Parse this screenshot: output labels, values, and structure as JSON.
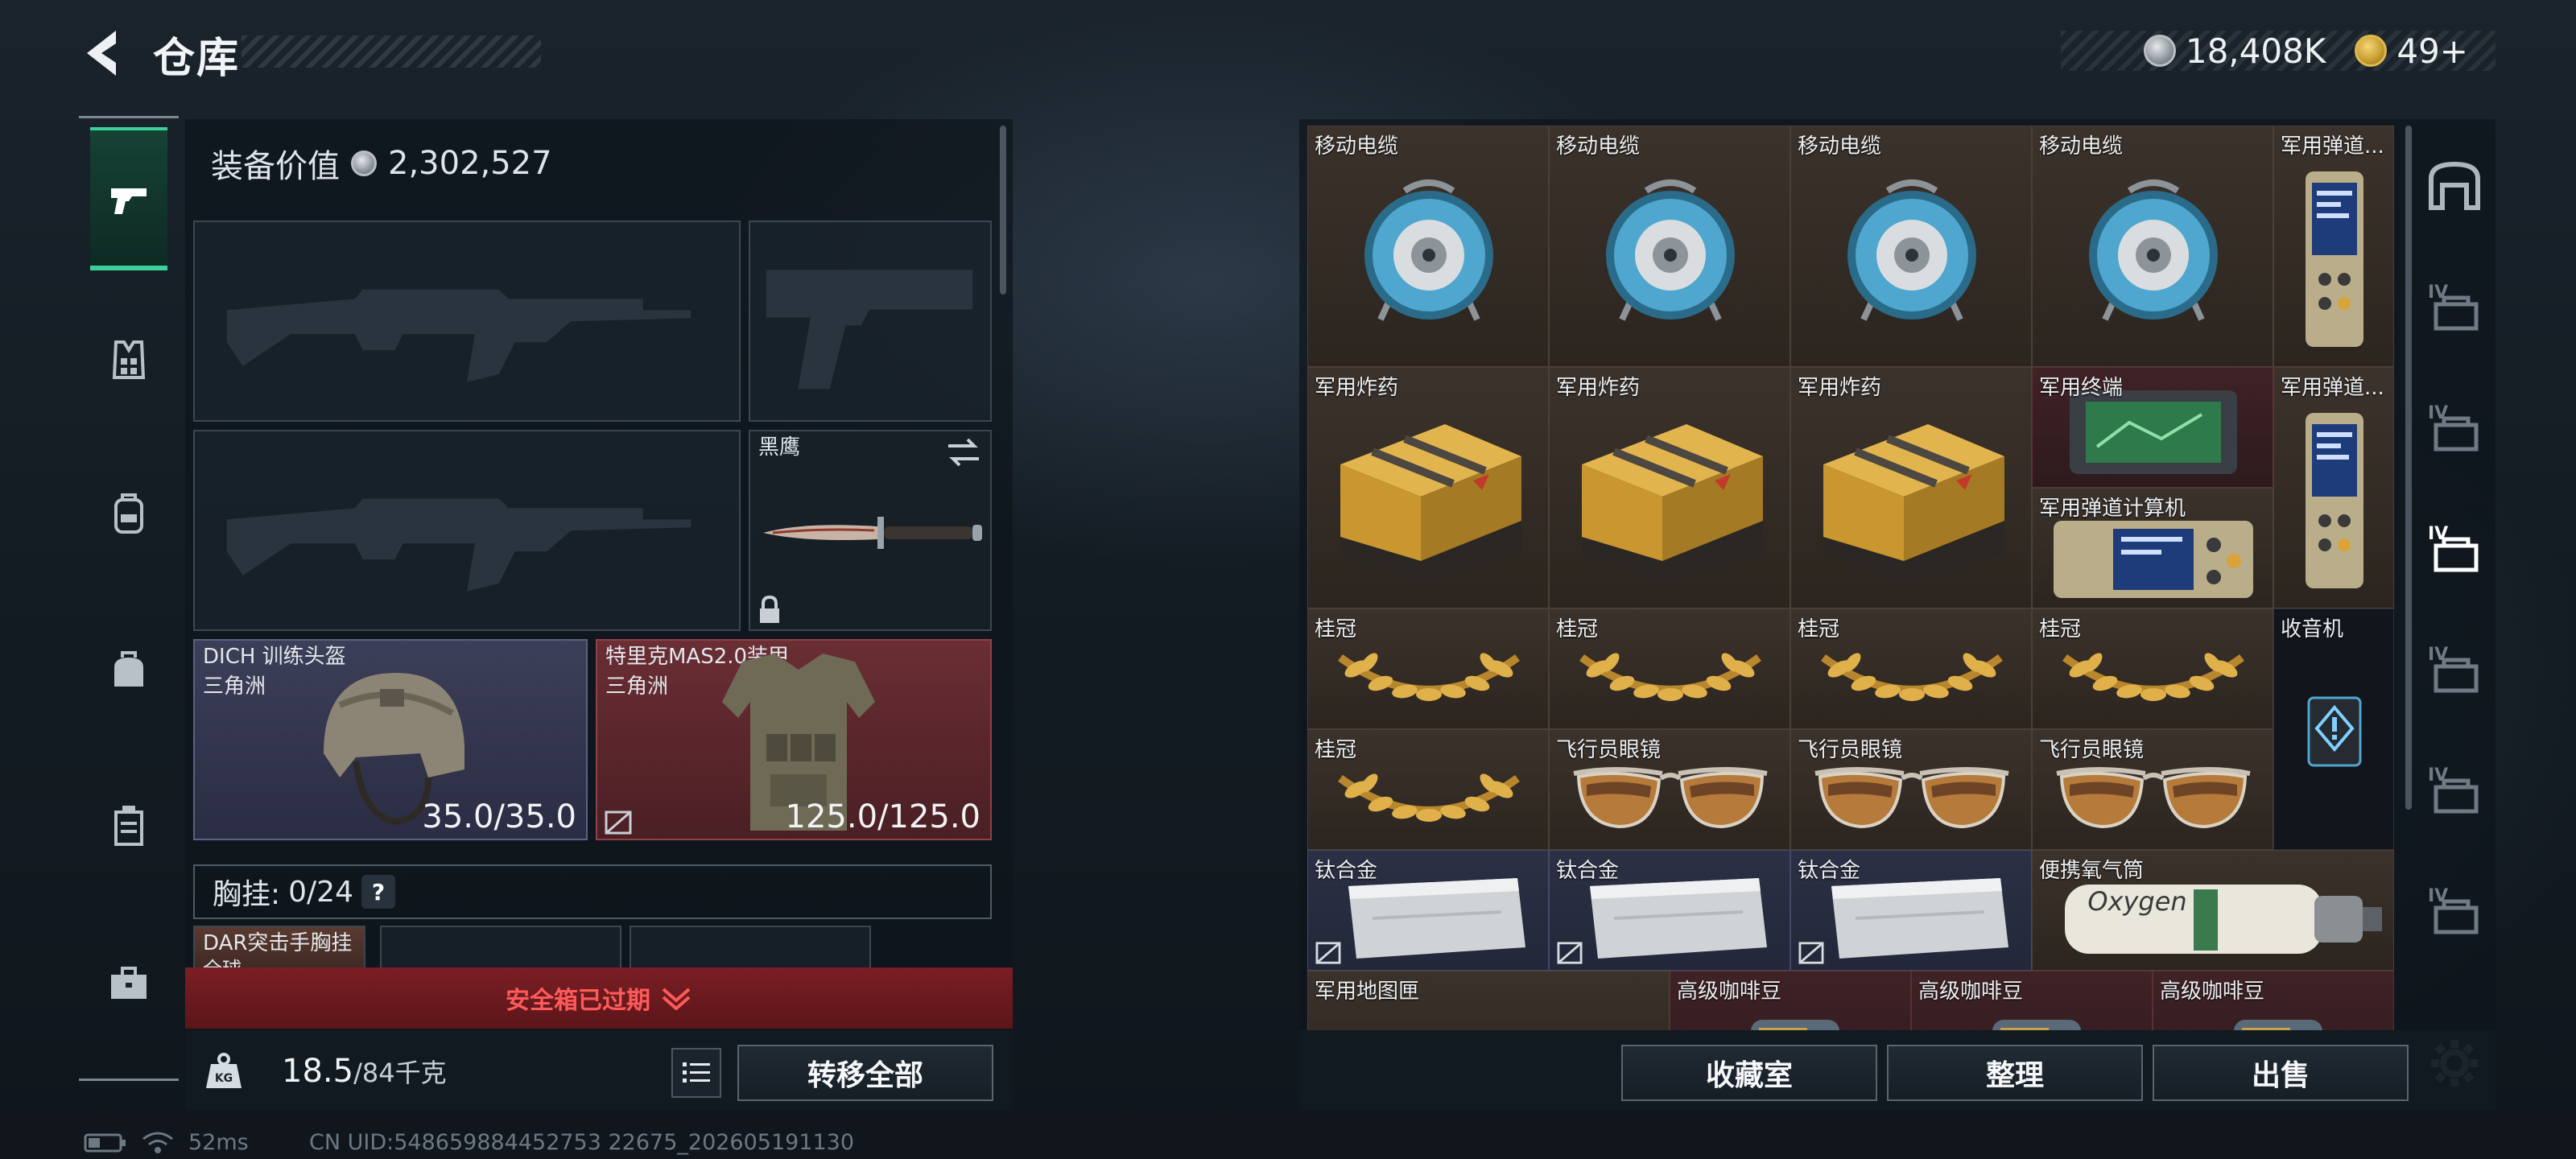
{
  "header": {
    "title": "仓库",
    "currency": [
      {
        "icon": "silver-coin-icon",
        "value": "18,408K"
      },
      {
        "icon": "gold-coin-icon",
        "value": "49+"
      }
    ]
  },
  "left_rail": {
    "tabs": [
      {
        "name": "weapons-tab",
        "icon": "pistol-icon",
        "active": true
      },
      {
        "name": "vest-tab",
        "icon": "vest-icon",
        "active": false
      },
      {
        "name": "backpack-tab",
        "icon": "backpack-icon",
        "active": false
      },
      {
        "name": "bag-tab",
        "icon": "bag-icon",
        "active": false
      },
      {
        "name": "case-tab",
        "icon": "case-icon",
        "active": false
      },
      {
        "name": "toolbox-tab",
        "icon": "toolbox-icon",
        "active": false
      }
    ]
  },
  "loadout": {
    "equip_value_label": "装备价值",
    "equip_value": "2,302,527",
    "melee": {
      "name": "黑鹰"
    },
    "helmet": {
      "name": "DICH 训练头盔",
      "origin": "三角洲",
      "durability": "35.0/35.0"
    },
    "armor": {
      "name": "特里克MAS2.0装甲",
      "origin": "三角洲",
      "durability": "125.0/125.0"
    },
    "chest_rig": {
      "label": "胸挂:",
      "value": "0/24",
      "help": "?"
    },
    "chest_item": {
      "name": "DAR突击手胸挂",
      "origin": "全球..."
    },
    "safe_box_banner": "安全箱已过期",
    "weight": {
      "current": "18.5",
      "max": "/84千克"
    },
    "transfer_all": "转移全部"
  },
  "storage": {
    "items": [
      {
        "label": "移动电缆",
        "type": "reel"
      },
      {
        "label": "移动电缆",
        "type": "reel"
      },
      {
        "label": "移动电缆",
        "type": "reel"
      },
      {
        "label": "移动电缆",
        "type": "reel"
      },
      {
        "label": "军用弹道...",
        "type": "device"
      },
      {
        "label": "军用炸药",
        "type": "explosive"
      },
      {
        "label": "军用炸药",
        "type": "explosive"
      },
      {
        "label": "军用炸药",
        "type": "explosive"
      },
      {
        "label": "军用终端",
        "type": "terminal"
      },
      {
        "label": "军用弹道...",
        "type": "device"
      },
      {
        "label": "军用弹道计算机",
        "type": "device"
      },
      {
        "label": "桂冠",
        "type": "laurel"
      },
      {
        "label": "桂冠",
        "type": "laurel"
      },
      {
        "label": "桂冠",
        "type": "laurel"
      },
      {
        "label": "桂冠",
        "type": "laurel"
      },
      {
        "label": "收音机",
        "type": "radio"
      },
      {
        "label": "桂冠",
        "type": "laurel"
      },
      {
        "label": "飞行员眼镜",
        "type": "glasses"
      },
      {
        "label": "飞行员眼镜",
        "type": "glasses"
      },
      {
        "label": "飞行员眼镜",
        "type": "glasses"
      },
      {
        "label": "钛合金",
        "type": "metal"
      },
      {
        "label": "钛合金",
        "type": "metal"
      },
      {
        "label": "钛合金",
        "type": "metal"
      },
      {
        "label": "便携氧气筒",
        "type": "oxygen"
      },
      {
        "label": "军用地图匣",
        "type": "case"
      },
      {
        "label": "高级咖啡豆",
        "type": "coffee"
      },
      {
        "label": "高级咖啡豆",
        "type": "coffee"
      },
      {
        "label": "高级咖啡豆",
        "type": "coffee"
      }
    ],
    "oxygen_text": "Oxygen",
    "tier_label": "IV",
    "buttons": {
      "collection": "收藏室",
      "organize": "整理",
      "sell": "出售"
    }
  },
  "status": {
    "ping": "52ms",
    "uid": "CN UID:548659884452753 22675_202605191130"
  }
}
